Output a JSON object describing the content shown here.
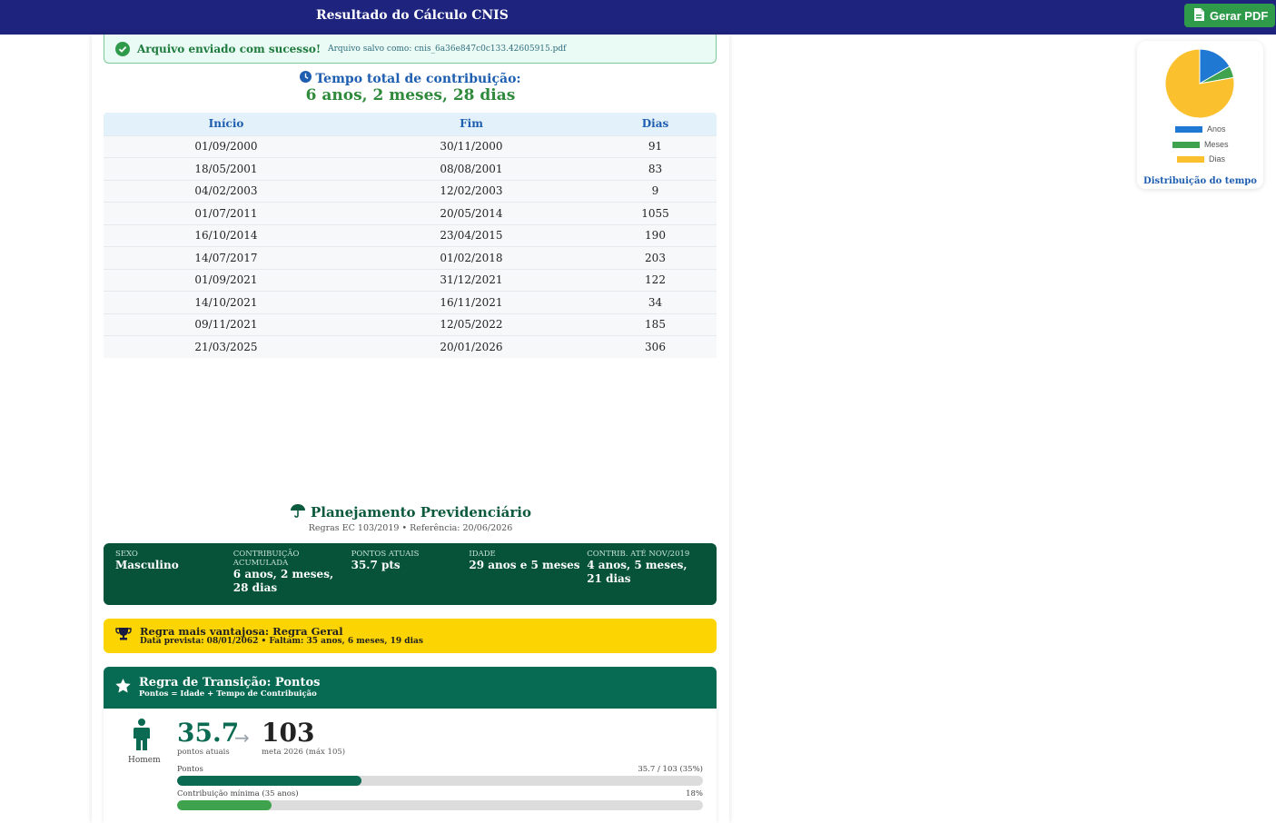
{
  "header": {
    "title": "Resultado do Cálculo CNIS",
    "pdf_button": "Gerar PDF"
  },
  "alert": {
    "message": "Arquivo enviado com sucesso!",
    "file": "Arquivo salvo como: cnis_6a36e847c0c133.42605915.pdf"
  },
  "total": {
    "label": "Tempo total de contribuição:",
    "value": "6 anos, 2 meses, 28 dias"
  },
  "periods": {
    "columns": [
      "Início",
      "Fim",
      "Dias"
    ],
    "rows": [
      [
        "01/09/2000",
        "30/11/2000",
        "91"
      ],
      [
        "18/05/2001",
        "08/08/2001",
        "83"
      ],
      [
        "04/02/2003",
        "12/02/2003",
        "9"
      ],
      [
        "01/07/2011",
        "20/05/2014",
        "1055"
      ],
      [
        "16/10/2014",
        "23/04/2015",
        "190"
      ],
      [
        "14/07/2017",
        "01/02/2018",
        "203"
      ],
      [
        "01/09/2021",
        "31/12/2021",
        "122"
      ],
      [
        "14/10/2021",
        "16/11/2021",
        "34"
      ],
      [
        "09/11/2021",
        "12/05/2022",
        "185"
      ],
      [
        "21/03/2025",
        "20/01/2026",
        "306"
      ]
    ]
  },
  "planning": {
    "title": "Planejamento Previdenciário",
    "subtitle": "Regras EC 103/2019 • Referência: 20/06/2026",
    "summary": [
      {
        "label": "SEXO",
        "value": "Masculino"
      },
      {
        "label": "CONTRIBUIÇÃO ACUMULADA",
        "value": "6 anos, 2 meses, 28 dias"
      },
      {
        "label": "PONTOS ATUAIS",
        "value": "35.7 pts"
      },
      {
        "label": "IDADE",
        "value": "29 anos e 5 meses"
      },
      {
        "label": "CONTRIB. ATÉ NOV/2019",
        "value": "4 anos, 5 meses, 21 dias"
      }
    ]
  },
  "best_rule": {
    "title": "Regra mais vantajosa: Regra Geral",
    "detail": "Data prevista: 08/01/2062 • Faltam: 35 anos, 6 meses, 19 dias"
  },
  "transition": {
    "title": "Regra de Transição: Pontos",
    "subtitle": "Pontos = Idade + Tempo de Contribuição",
    "person_label": "Homem",
    "current_points": "35.7",
    "current_label": "pontos atuais",
    "goal_points": "103",
    "goal_label": "meta 2026 (máx 105)",
    "bars": [
      {
        "label": "Pontos",
        "value_text": "35.7 / 103 (35%)",
        "fraction": 0.35,
        "color": "#0b6a52"
      },
      {
        "label": "Contribuição mínima (35 anos)",
        "value_text": "18%",
        "fraction": 0.18,
        "color": "#3fa34d"
      }
    ]
  },
  "chart_data": {
    "type": "pie",
    "title": "Distribuição do tempo",
    "labels": [
      "Anos",
      "Meses",
      "Dias"
    ],
    "values": [
      6,
      2,
      28
    ],
    "colors": [
      "#1f78d1",
      "#3fa34d",
      "#fbc02d"
    ]
  }
}
